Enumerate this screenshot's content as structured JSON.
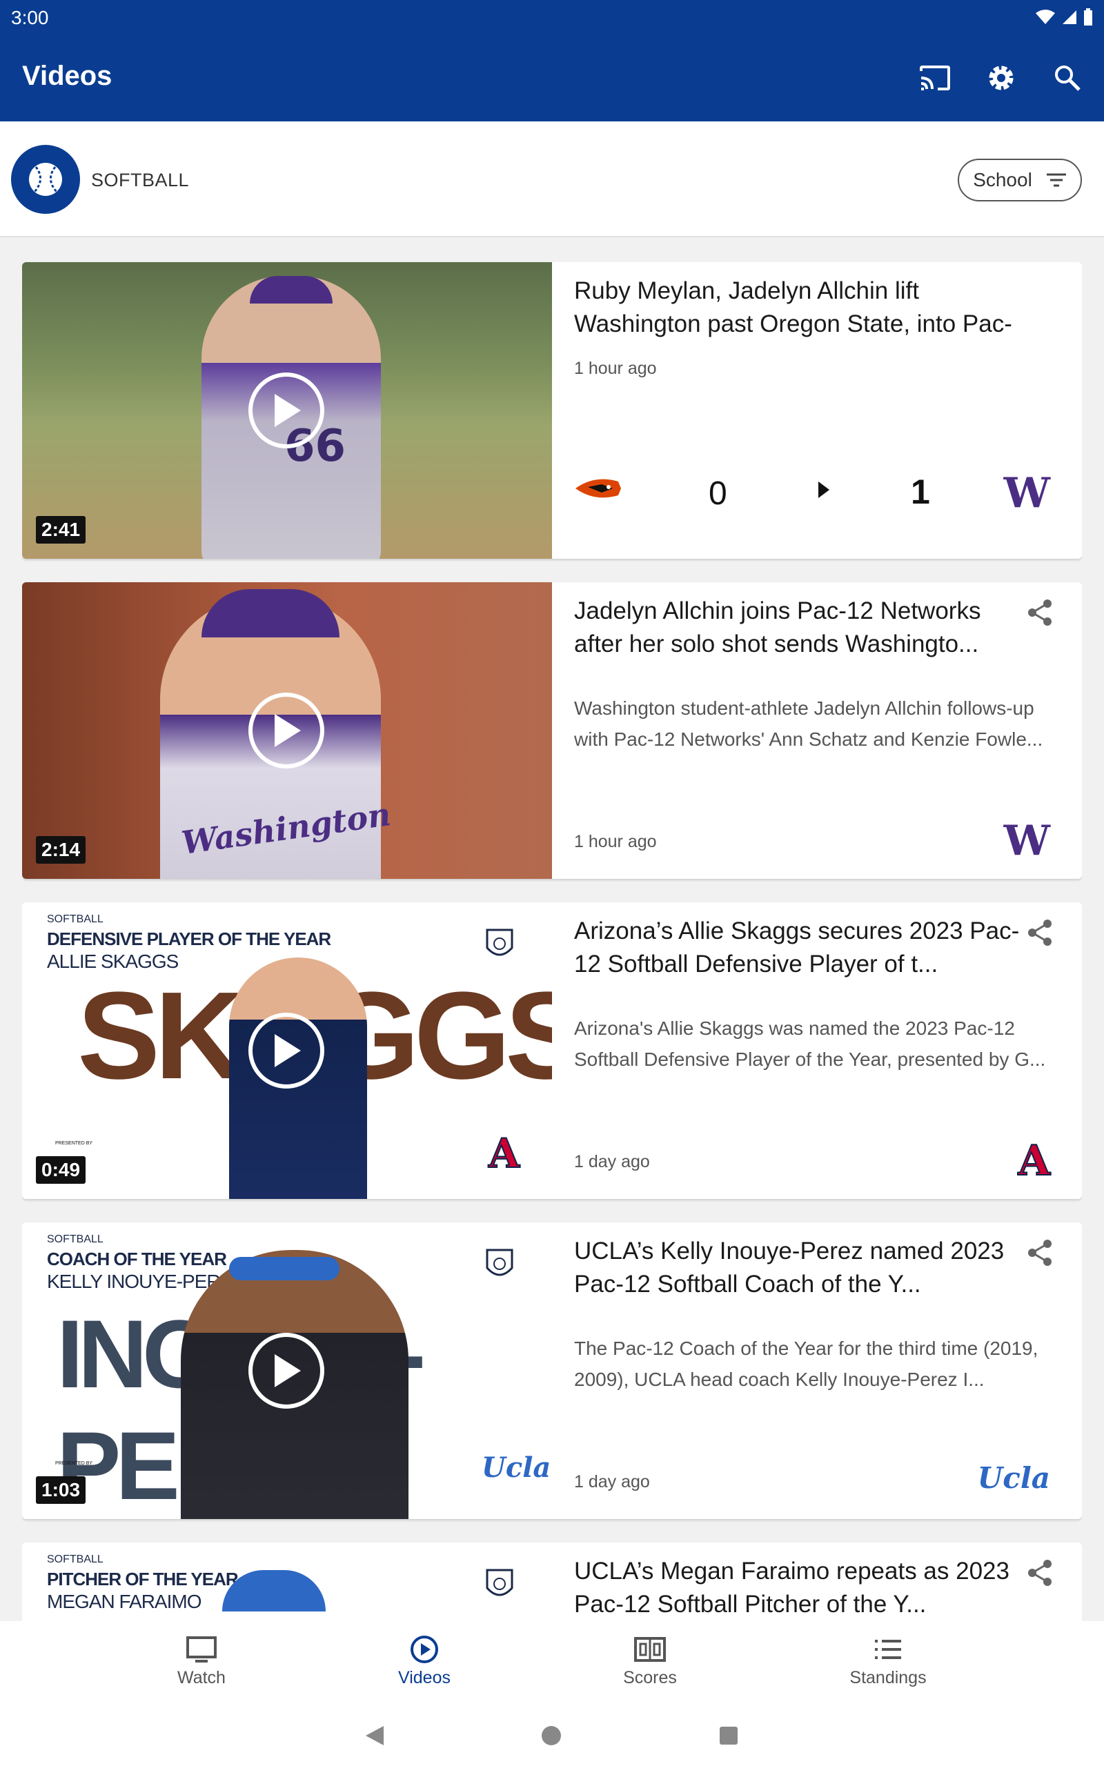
{
  "status": {
    "time": "3:00"
  },
  "appbar": {
    "title": "Videos",
    "icons": [
      "cast-icon",
      "gear-icon",
      "search-icon"
    ]
  },
  "sport": {
    "label": "SOFTBALL",
    "filter_label": "School"
  },
  "colors": {
    "brand": "#0a3d91",
    "washington_purple": "#4b2e83",
    "arizona_red": "#cc0033",
    "ucla_blue": "#2d68c4"
  },
  "videos": [
    {
      "duration": "2:41",
      "headline": "Ruby Meylan, Jadelyn Allchin lift Washington past Oregon State, into Pac-1...",
      "time": "1 hour ago",
      "score": {
        "away": "0",
        "home": "1",
        "home_logo": "W"
      }
    },
    {
      "duration": "2:14",
      "headline": "Jadelyn Allchin joins Pac-12 Networks after her solo shot sends Washingto...",
      "description": "Washington student-athlete Jadelyn Allchin follows-up with Pac-12 Networks' Ann Schatz and Kenzie Fowle...",
      "time": "1 hour ago",
      "team_logo": "W",
      "thumb_jersey": "Washington"
    },
    {
      "duration": "0:49",
      "headline": "Arizona’s Allie Skaggs secures 2023 Pac-12 Softball Defensive Player of t...",
      "description": "Arizona's Allie Skaggs was named the 2023 Pac-12 Softball Defensive Player of the Year, presented by G...",
      "time": "1 day ago",
      "team_logo": "A",
      "graphic": {
        "sport": "SOFTBALL",
        "award": "DEFENSIVE PLAYER OF THE YEAR",
        "name": "ALLIE SKAGGS",
        "big": "SKAGGS",
        "presented": "PRESENTED BY"
      }
    },
    {
      "duration": "1:03",
      "headline": "UCLA’s Kelly Inouye-Perez named 2023 Pac-12 Softball Coach of the Y...",
      "description": "The Pac-12 Coach of the Year for the third time (2019, 2009), UCLA head coach Kelly Inouye-Perez I...",
      "time": "1 day ago",
      "team_logo": "Ucla",
      "graphic": {
        "sport": "SOFTBALL",
        "award": "COACH OF THE YEAR",
        "name": "KELLY INOUYE-PEREZ",
        "big": "INOUYE-PEREZ",
        "presented": "PRESENTED BY"
      }
    },
    {
      "headline": "UCLA’s Megan Faraimo repeats as 2023 Pac-12 Softball Pitcher of the Y...",
      "graphic": {
        "sport": "SOFTBALL",
        "award": "PITCHER OF THE YEAR",
        "name": "MEGAN FARAIMO"
      }
    }
  ],
  "nav": {
    "items": [
      {
        "label": "Watch",
        "icon": "monitor-icon"
      },
      {
        "label": "Videos",
        "icon": "play-circle-icon"
      },
      {
        "label": "Scores",
        "icon": "scoreboard-icon"
      },
      {
        "label": "Standings",
        "icon": "list-icon"
      }
    ],
    "active": "Videos"
  }
}
